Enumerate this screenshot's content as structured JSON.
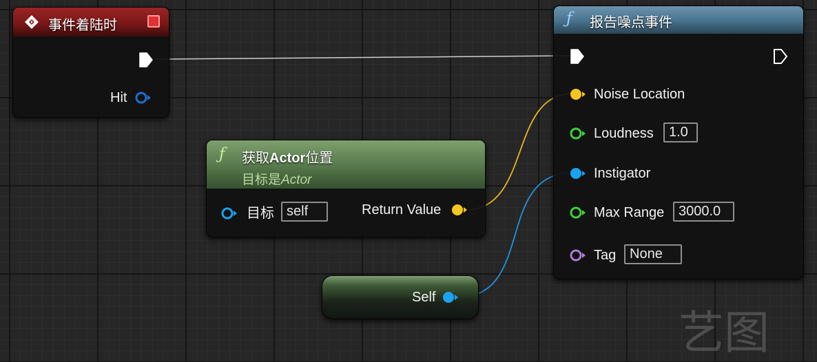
{
  "event_node": {
    "title": "事件着陆时",
    "pins": {
      "hit": "Hit"
    },
    "colors": {
      "header": "#8c1d1d",
      "stop_indicator": "#e03232"
    }
  },
  "report_node": {
    "title": "报告噪点事件",
    "icon": "function-f-icon",
    "pins": {
      "noise_location": "Noise Location",
      "loudness": "Loudness",
      "instigator": "Instigator",
      "max_range": "Max Range",
      "tag": "Tag"
    },
    "fields": {
      "loudness": "1.0",
      "max_range": "3000.0",
      "tag": "None"
    },
    "colors": {
      "header": "#4c7792"
    }
  },
  "get_location_node": {
    "title_prefix": "获取",
    "title_bold": "Actor",
    "title_suffix": "位置",
    "subtitle_prefix": "目标是",
    "subtitle_italic": "Actor",
    "icon": "function-f-icon",
    "pins": {
      "target": "目标",
      "return_value": "Return Value"
    },
    "fields": {
      "target": "self"
    },
    "colors": {
      "header": "#5b7c4f"
    }
  },
  "self_node": {
    "label": "Self"
  },
  "pin_colors": {
    "exec": "#ffffff",
    "vector": "#f5c521",
    "float": "#3cd23c",
    "object": "#1aa3f0",
    "name": "#b07ad8",
    "hit_struct": "#1e6fd0"
  },
  "watermark": "艺图"
}
